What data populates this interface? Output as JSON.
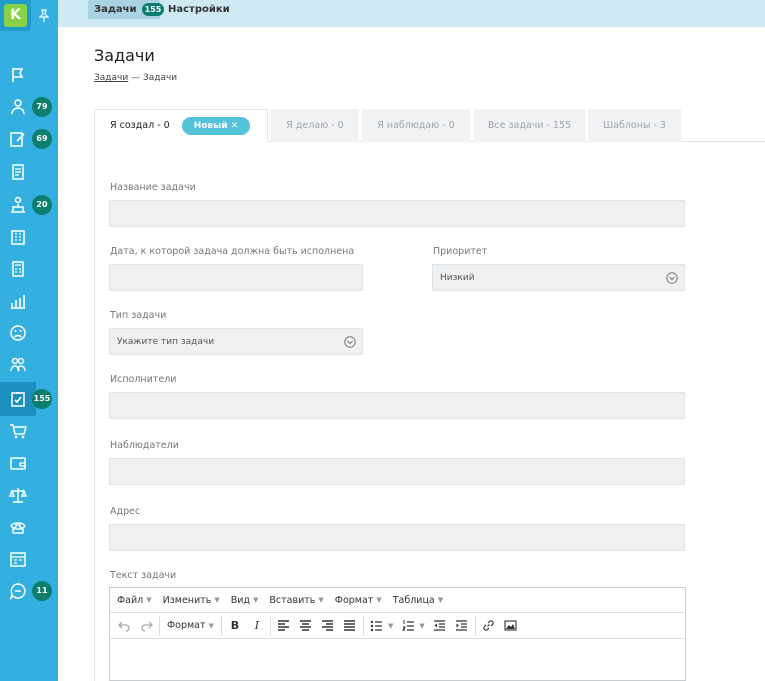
{
  "app": {
    "logo_letter": "K"
  },
  "sidebar": {
    "items": [
      {
        "icon": "flag-icon",
        "badge": ""
      },
      {
        "icon": "users-icon",
        "badge": "79"
      },
      {
        "icon": "edit-icon",
        "badge": "69"
      },
      {
        "icon": "documents-icon",
        "badge": ""
      },
      {
        "icon": "supervisor-icon",
        "badge": "20"
      },
      {
        "icon": "building-icon",
        "badge": ""
      },
      {
        "icon": "calculator-icon",
        "badge": ""
      },
      {
        "icon": "chart-icon",
        "badge": ""
      },
      {
        "icon": "frown-icon",
        "badge": ""
      },
      {
        "icon": "staff-icon",
        "badge": ""
      },
      {
        "icon": "tasks-icon",
        "badge": "155"
      },
      {
        "icon": "cart-icon",
        "badge": ""
      },
      {
        "icon": "wallet-icon",
        "badge": ""
      },
      {
        "icon": "scales-icon",
        "badge": ""
      },
      {
        "icon": "phone-icon",
        "badge": ""
      },
      {
        "icon": "calendar-icon",
        "badge": ""
      },
      {
        "icon": "chat-icon",
        "badge": "11"
      }
    ]
  },
  "topbar": {
    "tabs": [
      {
        "label": "Задачи",
        "badge": "155"
      },
      {
        "label": "Настройки"
      }
    ]
  },
  "page": {
    "title": "Задачи",
    "breadcrumb": {
      "link": "Задачи",
      "sep": "—",
      "current": "Задачи"
    }
  },
  "tabs": [
    {
      "label": "Я создал - 0",
      "chip": "Новый ✕"
    },
    {
      "label": "Я делаю - 0"
    },
    {
      "label": "Я наблюдаю - 0"
    },
    {
      "label": "Все задачи - 155"
    },
    {
      "label": "Шаблоны - 3"
    }
  ],
  "form": {
    "name_label": "Название задачи",
    "name_value": "",
    "due_label": "Дата, к которой задача должна быть исполнена",
    "due_value": "",
    "priority_label": "Приоритет",
    "priority_value": "Низкий",
    "type_label": "Тип задачи",
    "type_placeholder": "Укажите тип задачи",
    "executors_label": "Исполнители",
    "observers_label": "Наблюдатели",
    "address_label": "Адрес",
    "text_label": "Текст задачи"
  },
  "editor": {
    "menu": [
      "Файл",
      "Изменить",
      "Вид",
      "Вставить",
      "Формат",
      "Таблица"
    ],
    "format_label": "Формат"
  },
  "colors": {
    "sidebar": "#33b0e0",
    "badge": "#0d7d6e",
    "chip": "#54c2d9",
    "topbar": "#cfe9f2"
  }
}
